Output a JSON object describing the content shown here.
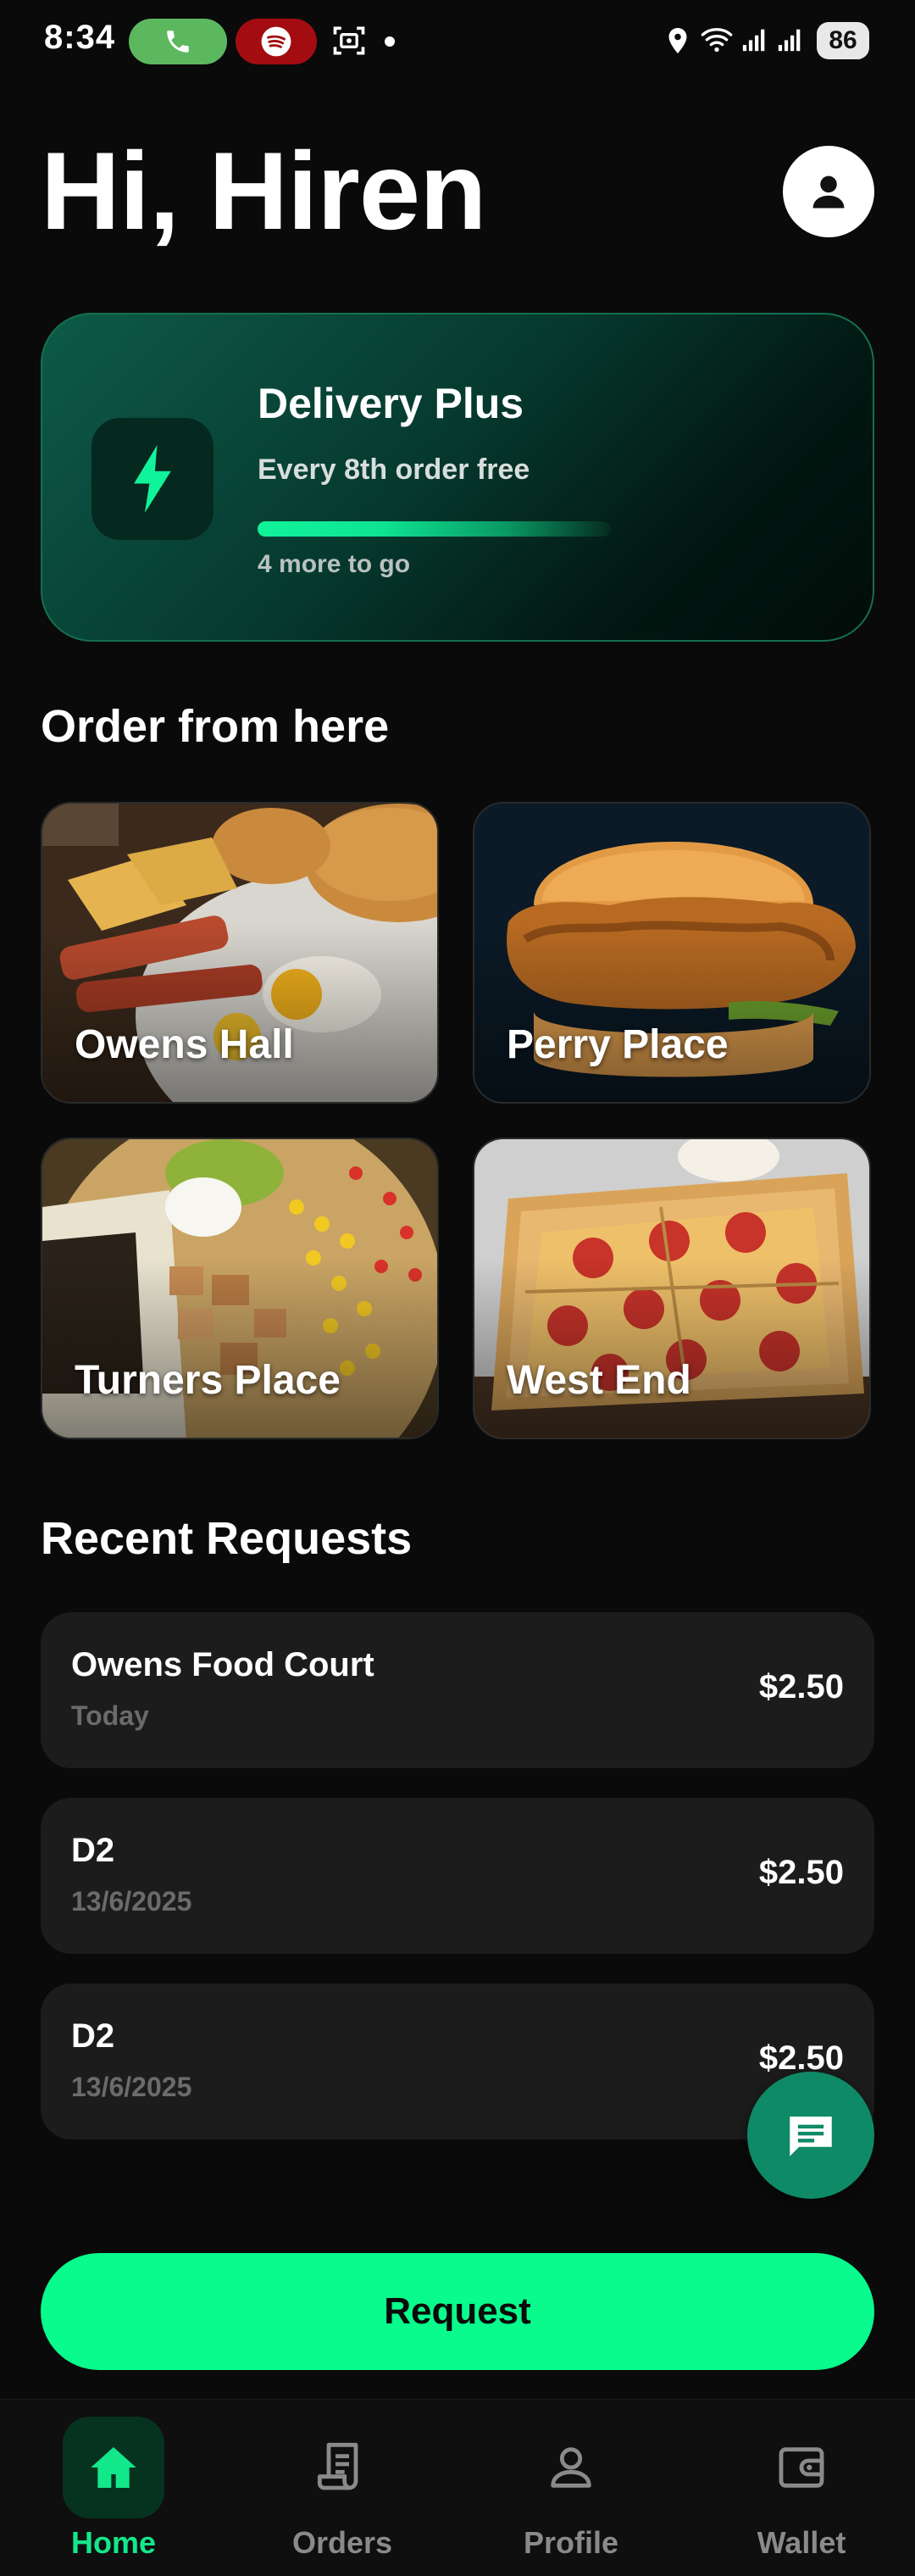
{
  "status_bar": {
    "time": "8:34",
    "battery": "86"
  },
  "header": {
    "greeting": "Hi, Hiren"
  },
  "delivery_plus": {
    "title": "Delivery Plus",
    "subtitle": "Every 8th order free",
    "progress": 0.5,
    "footer": "4 more to go",
    "accent": "#10f39a"
  },
  "order_section": {
    "title": "Order from here",
    "venues": [
      {
        "label": "Owens Hall"
      },
      {
        "label": "Perry Place"
      },
      {
        "label": "Turners Place"
      },
      {
        "label": "West End"
      }
    ]
  },
  "recent_section": {
    "title": "Recent Requests",
    "items": [
      {
        "name": "Owens Food Court",
        "date": "Today",
        "price": "$2.50"
      },
      {
        "name": "D2",
        "date": "13/6/2025",
        "price": "$2.50"
      },
      {
        "name": "D2",
        "date": "13/6/2025",
        "price": "$2.50"
      }
    ]
  },
  "request_button": {
    "label": "Request",
    "color": "#08fb8c"
  },
  "bottom_nav": {
    "items": [
      {
        "label": "Home",
        "icon": "home-icon",
        "active": true
      },
      {
        "label": "Orders",
        "icon": "receipt-icon",
        "active": false
      },
      {
        "label": "Profile",
        "icon": "person-icon",
        "active": false
      },
      {
        "label": "Wallet",
        "icon": "wallet-icon",
        "active": false
      }
    ]
  }
}
